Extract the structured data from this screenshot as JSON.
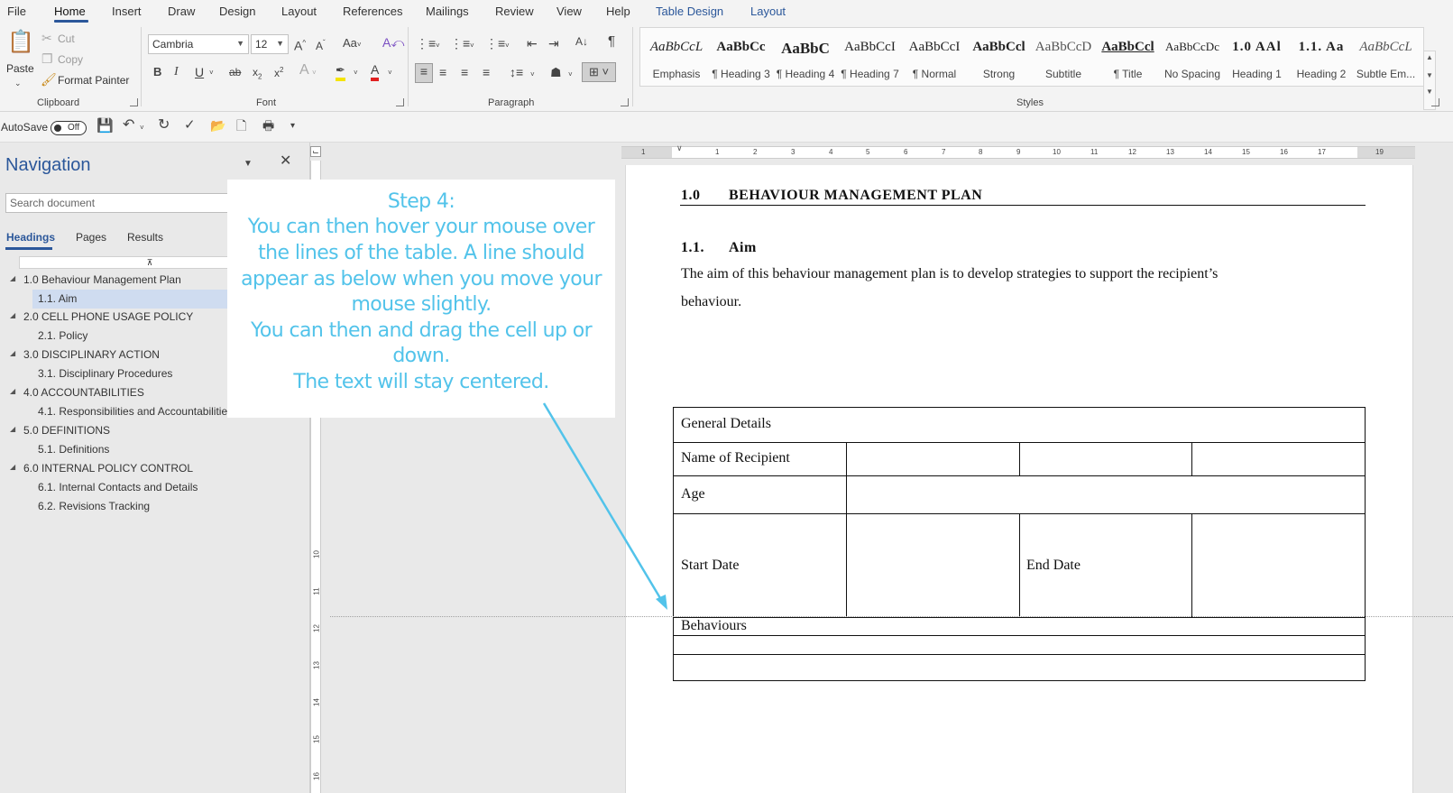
{
  "menubar": {
    "tabs": [
      "File",
      "Home",
      "Insert",
      "Draw",
      "Design",
      "Layout",
      "References",
      "Mailings",
      "Review",
      "View",
      "Help",
      "Table Design",
      "Layout"
    ],
    "active_tab": "Home"
  },
  "ribbon": {
    "clipboard": {
      "paste": "Paste",
      "cut": "Cut",
      "copy": "Copy",
      "format_painter": "Format Painter",
      "label": "Clipboard"
    },
    "font": {
      "family": "Cambria",
      "size": "12",
      "label": "Font",
      "change_case": "Aa"
    },
    "paragraph": {
      "label": "Paragraph"
    },
    "styles": {
      "label": "Styles",
      "items": [
        {
          "preview": "AaBbCcL",
          "name": "Emphasis"
        },
        {
          "preview": "AaBbCc",
          "name": "¶ Heading 3"
        },
        {
          "preview": "AaBbC",
          "name": "¶ Heading 4"
        },
        {
          "preview": "AaBbCcI",
          "name": "¶ Heading 7"
        },
        {
          "preview": "AaBbCcI",
          "name": "¶ Normal"
        },
        {
          "preview": "AaBbCcl",
          "name": "Strong"
        },
        {
          "preview": "AaBbCcD",
          "name": "Subtitle"
        },
        {
          "preview": "AaBbCcl",
          "name": "¶ Title"
        },
        {
          "preview": "AaBbCcDc",
          "name": "No Spacing"
        },
        {
          "preview": "1.0 AAl",
          "name": "Heading 1"
        },
        {
          "preview": "1.1. Aa",
          "name": "Heading 2"
        },
        {
          "preview": "AaBbCcL",
          "name": "Subtle Em..."
        }
      ]
    }
  },
  "qat": {
    "autosave": "AutoSave",
    "autosave_state": "Off"
  },
  "navigation": {
    "title": "Navigation",
    "search_placeholder": "Search document",
    "tabs": [
      "Headings",
      "Pages",
      "Results"
    ],
    "items": [
      {
        "text": "1.0 Behaviour Management Plan",
        "level": 1
      },
      {
        "text": "1.1. Aim",
        "level": 2,
        "selected": true
      },
      {
        "text": "2.0 CELL PHONE USAGE POLICY",
        "level": 1
      },
      {
        "text": "2.1. Policy",
        "level": 2
      },
      {
        "text": "3.0 DISCIPLINARY ACTION",
        "level": 1
      },
      {
        "text": "3.1. Disciplinary Procedures",
        "level": 2
      },
      {
        "text": "4.0 ACCOUNTABILITIES",
        "level": 1
      },
      {
        "text": "4.1. Responsibilities and Accountabilities",
        "level": 2
      },
      {
        "text": "5.0 DEFINITIONS",
        "level": 1
      },
      {
        "text": "5.1. Definitions",
        "level": 2
      },
      {
        "text": "6.0 INTERNAL POLICY CONTROL",
        "level": 1
      },
      {
        "text": "6.1. Internal Contacts and Details",
        "level": 2
      },
      {
        "text": "6.2. Revisions Tracking",
        "level": 2
      }
    ]
  },
  "ruler": {
    "h_numbers": [
      "1",
      "1",
      "2",
      "3",
      "4",
      "5",
      "6",
      "7",
      "8",
      "9",
      "10",
      "11",
      "12",
      "13",
      "14",
      "15",
      "16",
      "17",
      "19"
    ],
    "v_numbers": [
      "10",
      "11",
      "12",
      "13",
      "14",
      "15",
      "16"
    ]
  },
  "document": {
    "h1_num": "1.0",
    "h1_text": "BEHAVIOUR MANAGEMENT PLAN",
    "h2_num": "1.1.",
    "h2_text": "Aim",
    "para_line1": "The aim of this behaviour management plan is to develop strategies to support the recipient’s",
    "para_line2": "behaviour.",
    "table": {
      "general_details": "General Details",
      "name_of_recipient": "Name of Recipient",
      "age": "Age",
      "start_date": "Start Date",
      "end_date": "End Date",
      "behaviours": "Behaviours"
    }
  },
  "callout": {
    "lines": [
      "Step 4:",
      "You can then hover your mouse over",
      "the lines of the table. A line should",
      "appear as below when you move your",
      "mouse slightly.",
      "You can then and drag the cell up or",
      "down.",
      "The text will stay centered."
    ],
    "color": "#52c3ea"
  },
  "colors": {
    "accent": "#2b579a",
    "callout": "#52c3ea"
  }
}
